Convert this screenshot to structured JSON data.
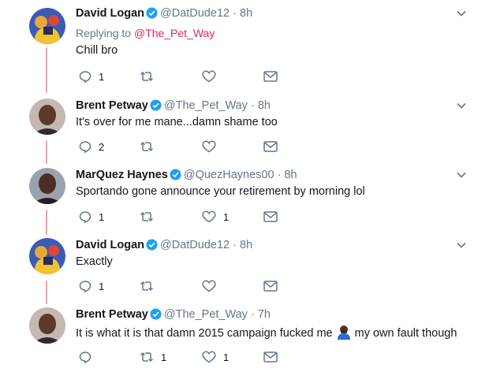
{
  "tweets": [
    {
      "name": "David Logan",
      "handle": "@DatDude12",
      "time": "8h",
      "reply_prefix": "Replying to",
      "reply_to": "@The_Pet_Way",
      "text": "Chill bro",
      "replies": "1",
      "retweets": "",
      "likes": "",
      "avatar": "cartoon-avatar"
    },
    {
      "name": "Brent Petway",
      "handle": "@The_Pet_Way",
      "time": "8h",
      "text": "It's over for me mane...damn shame too",
      "replies": "2",
      "retweets": "",
      "likes": "",
      "avatar": "photo-avatar"
    },
    {
      "name": "MarQuez Haynes",
      "handle": "@QuezHaynes00",
      "time": "8h",
      "text": "Sportando gone announce your retirement by morning lol",
      "replies": "1",
      "retweets": "",
      "likes": "1",
      "avatar": "photo-avatar"
    },
    {
      "name": "David Logan",
      "handle": "@DatDude12",
      "time": "8h",
      "text": "Exactly",
      "replies": "1",
      "retweets": "",
      "likes": "",
      "avatar": "cartoon-avatar"
    },
    {
      "name": "Brent Petway",
      "handle": "@The_Pet_Way",
      "time": "7h",
      "text_before": "It is what it is that damn 2015 campaign fucked me",
      "text_after": "my own fault though",
      "emoji": "person-facepalming-emoji",
      "replies": "",
      "retweets": "1",
      "likes": "1",
      "avatar": "photo-avatar"
    }
  ],
  "separator": "·",
  "colors": {
    "verified": "#1da1f2",
    "reply_link": "#e0245e",
    "thread_line": "#e8a3b3",
    "icon_gray": "#657786"
  }
}
